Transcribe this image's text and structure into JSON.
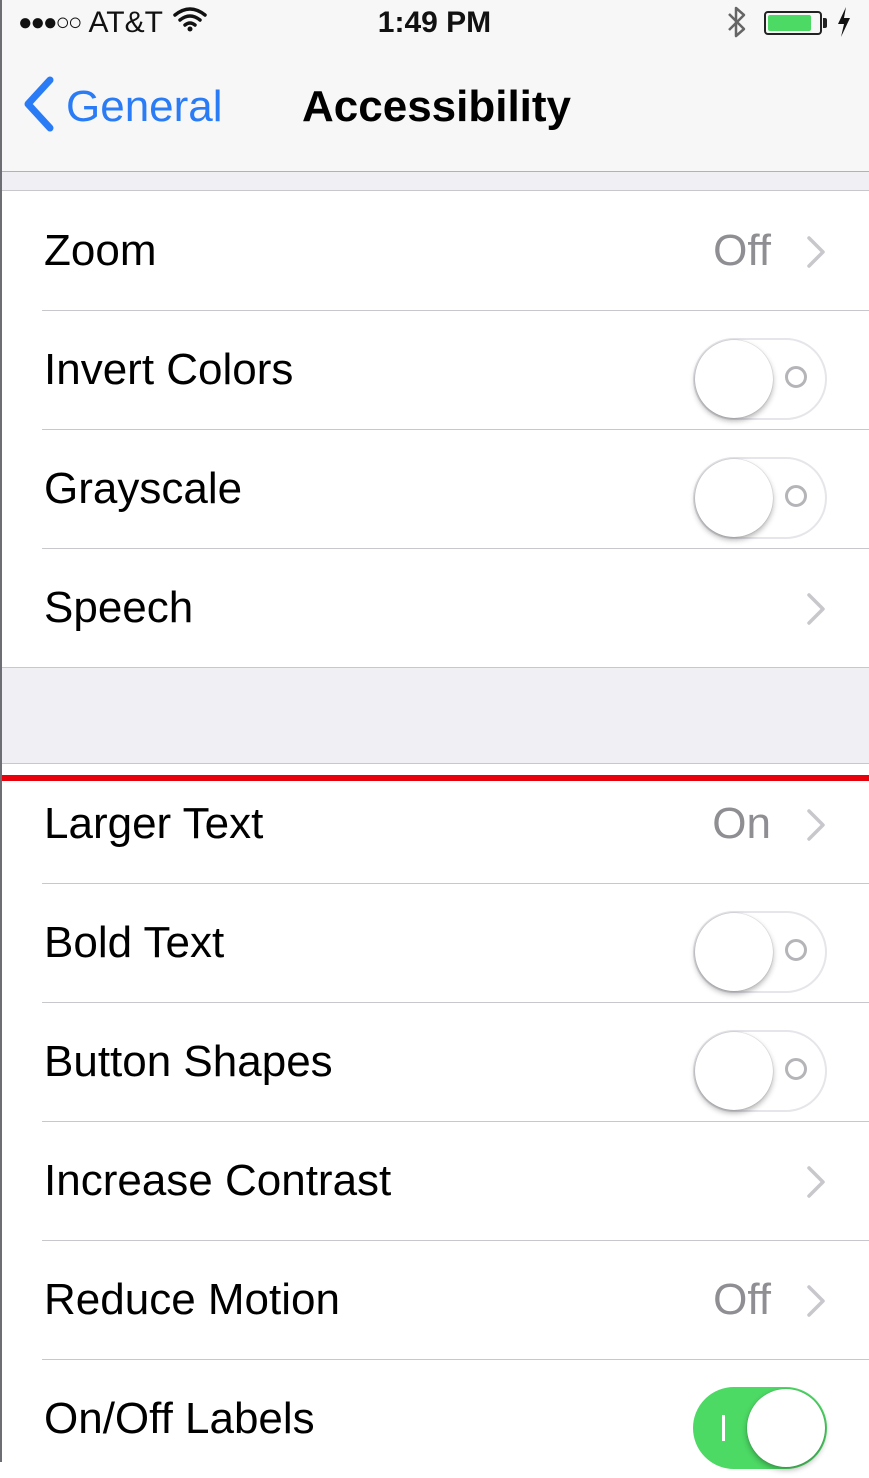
{
  "status_bar": {
    "signal": "●●●○○",
    "carrier": "AT&T",
    "time": "1:49 PM",
    "battery_level": 0.85
  },
  "nav": {
    "back_label": "General",
    "title": "Accessibility"
  },
  "groups": [
    {
      "rows": [
        {
          "label": "Zoom",
          "value": "Off",
          "control": "disclosure"
        },
        {
          "label": "Invert Colors",
          "control": "switch",
          "state": "off"
        },
        {
          "label": "Grayscale",
          "control": "switch",
          "state": "off"
        },
        {
          "label": "Speech",
          "control": "disclosure"
        }
      ]
    },
    {
      "rows": [
        {
          "label": "Larger Text",
          "value": "On",
          "control": "disclosure"
        },
        {
          "label": "Bold Text",
          "control": "switch",
          "state": "off"
        },
        {
          "label": "Button Shapes",
          "control": "switch",
          "state": "off"
        },
        {
          "label": "Increase Contrast",
          "control": "disclosure"
        },
        {
          "label": "Reduce Motion",
          "value": "Off",
          "control": "disclosure"
        },
        {
          "label": "On/Off Labels",
          "control": "switch",
          "state": "on"
        }
      ]
    }
  ],
  "colors": {
    "accent": "#2a7bf6",
    "switch_on": "#4cd964",
    "highlight_line": "#e8000a",
    "group_background": "#efeff4"
  },
  "icons": [
    "wifi-icon",
    "bluetooth-icon",
    "battery-icon",
    "charging-icon",
    "back-chevron-icon",
    "chevron-right-icon"
  ]
}
